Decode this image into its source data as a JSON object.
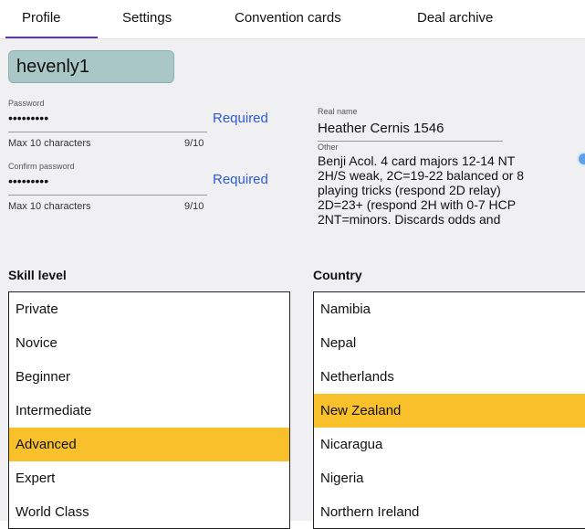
{
  "tabs": [
    {
      "label": "Profile",
      "active": true
    },
    {
      "label": "Settings",
      "active": false
    },
    {
      "label": "Convention cards",
      "active": false
    },
    {
      "label": "Deal archive",
      "active": false
    }
  ],
  "profile": {
    "username": "hevenly1",
    "password": {
      "label": "Password",
      "value": "•••••••••",
      "hint": "Max 10 characters",
      "counter": "9/10",
      "status": "Required"
    },
    "confirm_password": {
      "label": "Confirm password",
      "value": "•••••••••",
      "hint": "Max 10 characters",
      "counter": "9/10",
      "status": "Required"
    },
    "real_name": {
      "label": "Real name",
      "value": "Heather Cernis 1546"
    },
    "other": {
      "label": "Other",
      "value": "Benji Acol. 4 card majors 12-14 NT\n2H/S weak, 2C=19-22 balanced or 8\nplaying tricks (respond 2D relay)\n2D=23+ (respond 2H with 0-7 HCP\n2NT=minors. Discards odds and"
    }
  },
  "skill_level": {
    "title": "Skill level",
    "options": [
      "Private",
      "Novice",
      "Beginner",
      "Intermediate",
      "Advanced",
      "Expert",
      "World Class"
    ],
    "selected": "Advanced"
  },
  "country": {
    "title": "Country",
    "options": [
      "Namibia",
      "Nepal",
      "Netherlands",
      "New Zealand",
      "Nicaragua",
      "Nigeria",
      "Northern Ireland"
    ],
    "selected": "New Zealand"
  },
  "colors": {
    "accent": "#5b3aa0",
    "selection": "#f8c02a",
    "link": "#2d5bd6",
    "username_field": "#a9c7c7"
  }
}
